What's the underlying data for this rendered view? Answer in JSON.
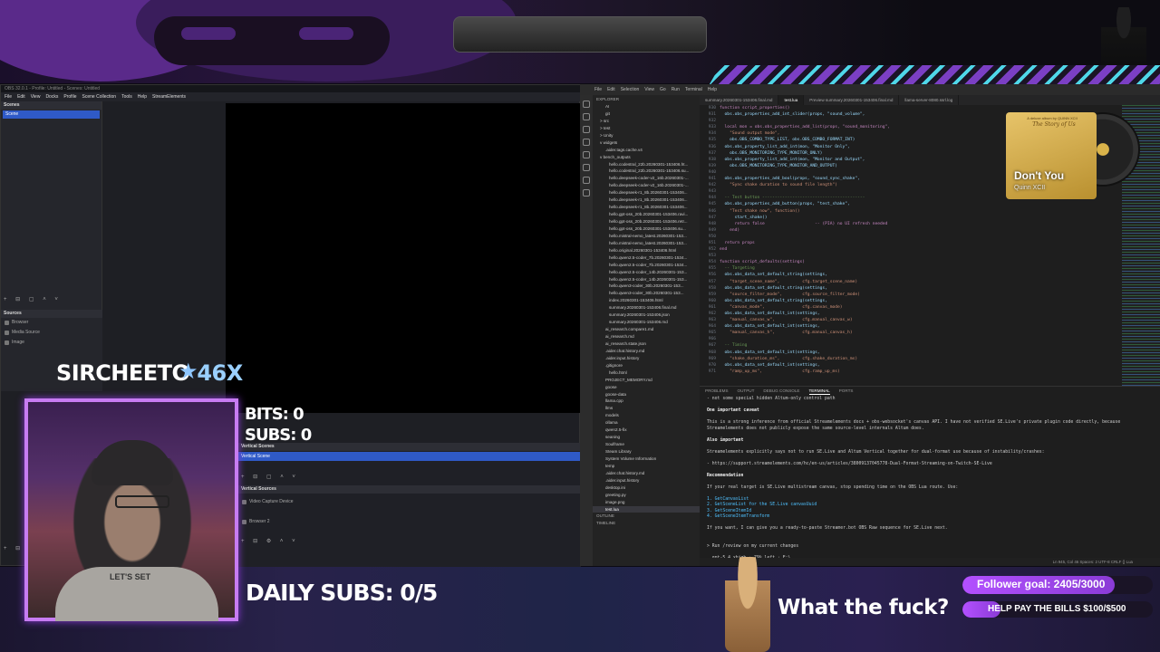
{
  "obs": {
    "title": "OBS 32.0.1 - Profile: Untitled - Scenes: Untitled",
    "menu": [
      "File",
      "Edit",
      "View",
      "Docks",
      "Profile",
      "Scene Collection",
      "Tools",
      "Help",
      "StreamElements"
    ],
    "scenes_title": "Scenes",
    "scene_selected": "Scene",
    "sources_title": "Sources",
    "sources": [
      "Browser",
      "Media Source",
      "Image"
    ],
    "vertical_scenes_title": "Vertical Scenes",
    "vertical_scene_selected": "Vertical Scene",
    "vertical_sources_title": "Vertical Sources",
    "vertical_sources": [
      "Video Capture Device",
      "Browser 2"
    ]
  },
  "vscode": {
    "menu": [
      "File",
      "Edit",
      "Selection",
      "View",
      "Go",
      "Run",
      "Terminal",
      "Help"
    ],
    "tabs": [
      "summary.20260301-153406.final.md",
      "test.lua",
      "Preview summary.20260301-153406.final.md",
      "llama-server-8080.ssrl.log"
    ],
    "active_tab_index": 1,
    "explorer_title": "EXPLORER",
    "explorer_items": [
      "AI",
      "git",
      "> src",
      "> test",
      "> Unity",
      "v widgets",
      ".aider.tags.cache.v4",
      "v bench_outputs",
      "hello.codestral_22b.20260301-153406.ht...",
      "hello.codestral_22b.20260301-153406.su...",
      "hello.deepseek-coder-v2_16b.20260301-...",
      "hello.deepseek-coder-v2_16b.20260301-...",
      "hello.deepseek-r1_8b.20260301-153406...",
      "hello.deepseek-r1_8b.20260301-153406...",
      "hello.deepseek-r1_8b.20260301-153406...",
      "hello.gpt-oss_20b.20260301-153406.ravi...",
      "hello.gpt-oss_20b.20260301-153406.retr...",
      "hello.gpt-oss_20b.20260301-153406.su...",
      "hello.mistral-nemo_latest.20260301-153...",
      "hello.mistral-nemo_latest.20260301-153...",
      "hello.original.20260301-153406.html",
      "hello.qwen2.5-coder_7b.20260301-1534...",
      "hello.qwen2.5-coder_7b.20260301-1534...",
      "hello.qwen2.5-coder_14b.20260301-153...",
      "hello.qwen2.5-coder_14b.20260301-153...",
      "hello.qwen3-coder_30b.20260301-153...",
      "hello.qwen3-coder_30b.20260301-153...",
      "index.20260301-153406.html",
      "summary.20260301-153406.final.md",
      "summary.20260301-153406.json",
      "summary.20260301-153406.md",
      "ai_research.compare1.md",
      "ai_research.md",
      "ai_research.state.json",
      ".aider.chat.history.md",
      ".aider.input.history",
      ".gitignore",
      "hello.html",
      "PROJECT_MEMORY.md",
      "goose",
      "goose-data",
      "llama.cpp",
      "llms",
      "models",
      "ollama",
      "qwen2.5-fix",
      "seaning",
      "Soulframe",
      "Steam Library",
      "System Volume Information",
      "temp",
      ".aider.chat.history.md",
      ".aider.input.history",
      "desktop.ini",
      "greeting.py",
      "image.png",
      "test.lua"
    ],
    "outline_label": "OUTLINE",
    "timeline_label": "TIMELINE",
    "code_start_line": 930,
    "code": [
      "function script_properties()",
      "  obs.obs_properties_add_int_slider(props, \"sound_volume\",",
      "",
      "  local mon = obs.obs_properties_add_list(props, \"sound_monitoring\",",
      "    \"Sound output mode\",",
      "    obs.OBS_COMBO_TYPE_LIST, obs.OBS_COMBO_FORMAT_INT)",
      "  obs.obs_property_list_add_int(mon, \"Monitor Only\",",
      "    obs.OBS_MONITORING_TYPE_MONITOR_ONLY)",
      "  obs.obs_property_list_add_int(mon, \"Monitor and Output\",",
      "    obs.OBS_MONITORING_TYPE_MONITOR_AND_OUTPUT)",
      "",
      "  obs.obs_properties_add_bool(props, \"sound_sync_shake\",",
      "    \"Sync shake duration to sound file length\")",
      "",
      "  -- Test button -----------------------------------------",
      "  obs.obs_properties_add_button(props, \"test_shake\",",
      "    \"Test shake now\", function()",
      "      start_shake()",
      "      return false                    -- (PIA) no UI refresh needed",
      "    end)",
      "",
      "  return props",
      "end",
      "",
      "function script_defaults(settings)",
      "  -- Targeting",
      "  obs.obs_data_set_default_string(settings,",
      "    \"target_scene_name\",         cfg.target_scene_name)",
      "  obs.obs_data_set_default_string(settings,",
      "    \"source_filter_mode\",        cfg.source_filter_mode)",
      "  obs.obs_data_set_default_string(settings,",
      "    \"canvas_mode\",               cfg.canvas_mode)",
      "  obs.obs_data_set_default_int(settings,",
      "    \"manual_canvas_w\",           cfg.manual_canvas_w)",
      "  obs.obs_data_set_default_int(settings,",
      "    \"manual_canvas_h\",           cfg.manual_canvas_h)",
      "",
      "  -- Timing",
      "  obs.obs_data_set_default_int(settings,",
      "    \"shake_duration_ms\",         cfg.shake_duration_ms)",
      "  obs.obs_data_set_default_int(settings,",
      "    \"ramp_up_ms\",                cfg.ramp_up_ms)"
    ],
    "panel_tabs": [
      "PROBLEMS",
      "OUTPUT",
      "DEBUG CONSOLE",
      "TERMINAL",
      "PORTS"
    ],
    "active_panel_tab": 3,
    "terminal": [
      {
        "t": "- not some special hidden Altum-only control path",
        "c": ""
      },
      {
        "t": "",
        "c": ""
      },
      {
        "t": "One important caveat",
        "c": "b"
      },
      {
        "t": "",
        "c": ""
      },
      {
        "t": "This is a strong inference from official Streamelements docs + obs-websocket's canvas API. I have not verified SE.Live's private plugin code directly, because Streamelements does not publicly expose the same source-level internals Altum does.",
        "c": ""
      },
      {
        "t": "",
        "c": ""
      },
      {
        "t": "Also important",
        "c": "b"
      },
      {
        "t": "",
        "c": ""
      },
      {
        "t": "Streamelements explicitly says not to run SE.Live and Altum Vertical together for dual-format use because of instability/crashes:",
        "c": ""
      },
      {
        "t": "",
        "c": ""
      },
      {
        "t": "- https://support.streamelements.com/hc/en-us/articles/38009137045778-Dual-Format-Streaming-on-Twitch-SE-Live",
        "c": ""
      },
      {
        "t": "",
        "c": ""
      },
      {
        "t": "Recommendation",
        "c": "b"
      },
      {
        "t": "",
        "c": ""
      },
      {
        "t": "If your real target is SE.Live multistream canvas, stop spending time on the OBS Lua route. Use:",
        "c": ""
      },
      {
        "t": "",
        "c": ""
      },
      {
        "t": "1. GetCanvasList",
        "c": "lnk"
      },
      {
        "t": "2. GetSceneList for the SE.Live canvasUuid",
        "c": "lnk"
      },
      {
        "t": "3. GetSceneItemId",
        "c": "lnk"
      },
      {
        "t": "4. GetSceneItemTransform",
        "c": "lnk"
      },
      {
        "t": "",
        "c": ""
      },
      {
        "t": "If you want, I can give you a ready-to-paste Streamer.bot OBS Raw sequence for SE.Live next.",
        "c": ""
      },
      {
        "t": "",
        "c": ""
      },
      {
        "t": "",
        "c": ""
      },
      {
        "t": "> Run /review on my current changes",
        "c": ""
      },
      {
        "t": "",
        "c": ""
      },
      {
        "t": "  gpt-5.4 xhigh · 79% left · E:\\",
        "c": ""
      }
    ],
    "status_text": "Ln 945, Col 46   Spaces: 2   UTF-8   CRLF   {} Lua"
  },
  "music": {
    "album_label": "A deluxe album by QUINN XCII",
    "album_title": "The Story of Us",
    "song": "Don't You",
    "artist": "Quinn XCII"
  },
  "overlay": {
    "streamer_name": "SIRCHEETO",
    "multiplier": "46X",
    "bits": "BITS: 0",
    "subs": "SUBS: 0",
    "daily_subs": "DAILY SUBS: 0/5",
    "caption": "What the fuck?",
    "cam_shirt": "LET'S SET",
    "follower_goal": "Follower goal:  2405/3000",
    "follower_current": 2405,
    "follower_target": 3000,
    "bills_label": "HELP PAY THE BILLS  $100/$500",
    "bills_current": 100,
    "bills_target": 500,
    "accent": "#b350ff",
    "secondary": "#4fd7e8"
  }
}
